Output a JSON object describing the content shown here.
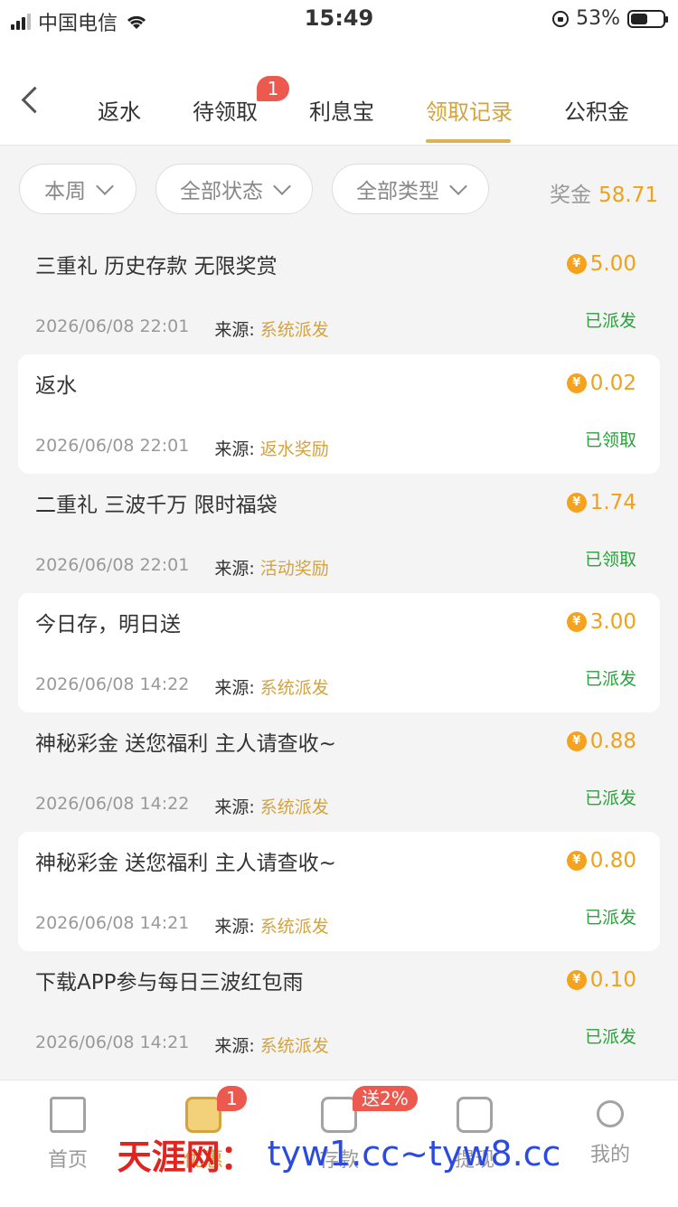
{
  "status_bar": {
    "carrier": "中国电信",
    "time": "15:49",
    "battery": "53%",
    "battery_level": 0.53
  },
  "nav": {
    "tabs": [
      {
        "label": "返水"
      },
      {
        "label": "待领取",
        "badge": "1"
      },
      {
        "label": "利息宝"
      },
      {
        "label": "领取记录",
        "active": true
      },
      {
        "label": "公积金"
      }
    ]
  },
  "filters": {
    "period": "本周",
    "status": "全部状态",
    "type": "全部类型",
    "bonus_label": "奖金",
    "bonus_value": "58.71"
  },
  "records": [
    {
      "title": "三重礼 历史存款 无限奖赏",
      "amount": "5.00",
      "date": "2026/06/08 22:01",
      "source_label": "来源:",
      "source": "系统派发",
      "status": "已派发"
    },
    {
      "title": "返水",
      "amount": "0.02",
      "date": "2026/06/08 22:01",
      "source_label": "来源:",
      "source": "返水奖励",
      "status": "已领取"
    },
    {
      "title": "二重礼  三波千万 限时福袋",
      "amount": "1.74",
      "date": "2026/06/08 22:01",
      "source_label": "来源:",
      "source": "活动奖励",
      "status": "已领取"
    },
    {
      "title": "今日存，明日送",
      "amount": "3.00",
      "date": "2026/06/08 14:22",
      "source_label": "来源:",
      "source": "系统派发",
      "status": "已派发"
    },
    {
      "title": "神秘彩金 送您福利 主人请查收~",
      "amount": "0.88",
      "date": "2026/06/08 14:22",
      "source_label": "来源:",
      "source": "系统派发",
      "status": "已派发"
    },
    {
      "title": "神秘彩金 送您福利 主人请查收~",
      "amount": "0.80",
      "date": "2026/06/08 14:21",
      "source_label": "来源:",
      "source": "系统派发",
      "status": "已派发"
    },
    {
      "title": "下载APP参与每日三波红包雨",
      "amount": "0.10",
      "date": "2026/06/08 14:21",
      "source_label": "来源:",
      "source": "系统派发",
      "status": "已派发"
    }
  ],
  "coin_symbol": "¥",
  "tab_bar": {
    "items": [
      {
        "label": "首页",
        "icon": "home-icon"
      },
      {
        "label": "优惠",
        "icon": "gift-icon",
        "badge": "1",
        "active": true
      },
      {
        "label": "存款",
        "icon": "wallet-icon",
        "badge": "送2%"
      },
      {
        "label": "提现",
        "icon": "cash-icon"
      },
      {
        "label": "我的",
        "icon": "user-icon"
      }
    ]
  },
  "watermark": {
    "site": "天涯网：",
    "urls": "tyw1.cc~tyw8.cc"
  },
  "colors": {
    "accent": "#d4a33d",
    "amount": "#f0a11c",
    "status_green": "#2aa13b",
    "badge_red": "#ec5a4f"
  }
}
